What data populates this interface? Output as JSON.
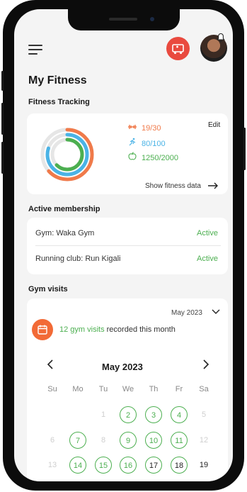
{
  "header": {
    "title": "My Fitness"
  },
  "fitness_tracking": {
    "heading": "Fitness Tracking",
    "edit_label": "Edit",
    "stats": [
      {
        "icon": "dumbbell-icon",
        "value": "19/30",
        "color": "#f07a4a"
      },
      {
        "icon": "running-icon",
        "value": "80/100",
        "color": "#4ab3e6"
      },
      {
        "icon": "apple-icon",
        "value": "1250/2000",
        "color": "#4caf50"
      }
    ],
    "show_link": "Show fitness data",
    "ring_progress": [
      0.633,
      0.8,
      0.625
    ]
  },
  "membership": {
    "heading": "Active membership",
    "items": [
      {
        "name": "Gym: Waka Gym",
        "status": "Active"
      },
      {
        "name": "Running club: Run Kigali",
        "status": "Active"
      }
    ]
  },
  "gym_visits": {
    "heading": "Gym visits",
    "month_select": "May 2023",
    "count_text": "12 gym visits",
    "count_suffix": "recorded this month",
    "calendar_title": "May 2023",
    "weekdays": [
      "Su",
      "Mo",
      "Tu",
      "We",
      "Th",
      "Fr",
      "Sa"
    ],
    "rows": [
      [
        null,
        null,
        "1",
        "2",
        "3",
        "4",
        "5"
      ],
      [
        "6",
        "7",
        "8",
        "9",
        "10",
        "11",
        "12"
      ],
      [
        "13",
        "14",
        "15",
        "16",
        "17",
        "18",
        "19"
      ]
    ]
  },
  "colors": {
    "accent": "#e94a3f",
    "orange": "#f07a4a",
    "blue": "#4ab3e6",
    "green": "#4caf50"
  }
}
